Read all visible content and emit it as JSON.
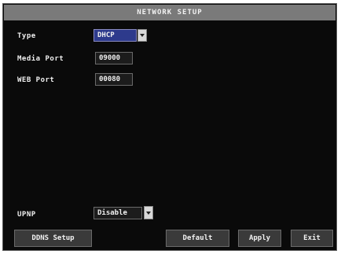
{
  "window": {
    "title": "NETWORK SETUP"
  },
  "fields": {
    "type": {
      "label": "Type",
      "value": "DHCP"
    },
    "media": {
      "label": "Media Port",
      "value": "09000"
    },
    "web": {
      "label": "WEB Port",
      "value": "00080"
    },
    "upnp": {
      "label": "UPNP",
      "value": "Disable"
    }
  },
  "buttons": {
    "ddns": "DDNS Setup",
    "default": "Default",
    "apply": "Apply",
    "exit": "Exit"
  },
  "colors": {
    "background": "#0a0a0a",
    "title_bar": "#7a7a7a",
    "selected": "#2d3a8c"
  },
  "icons": {
    "dropdown": "chevron-down-icon"
  }
}
